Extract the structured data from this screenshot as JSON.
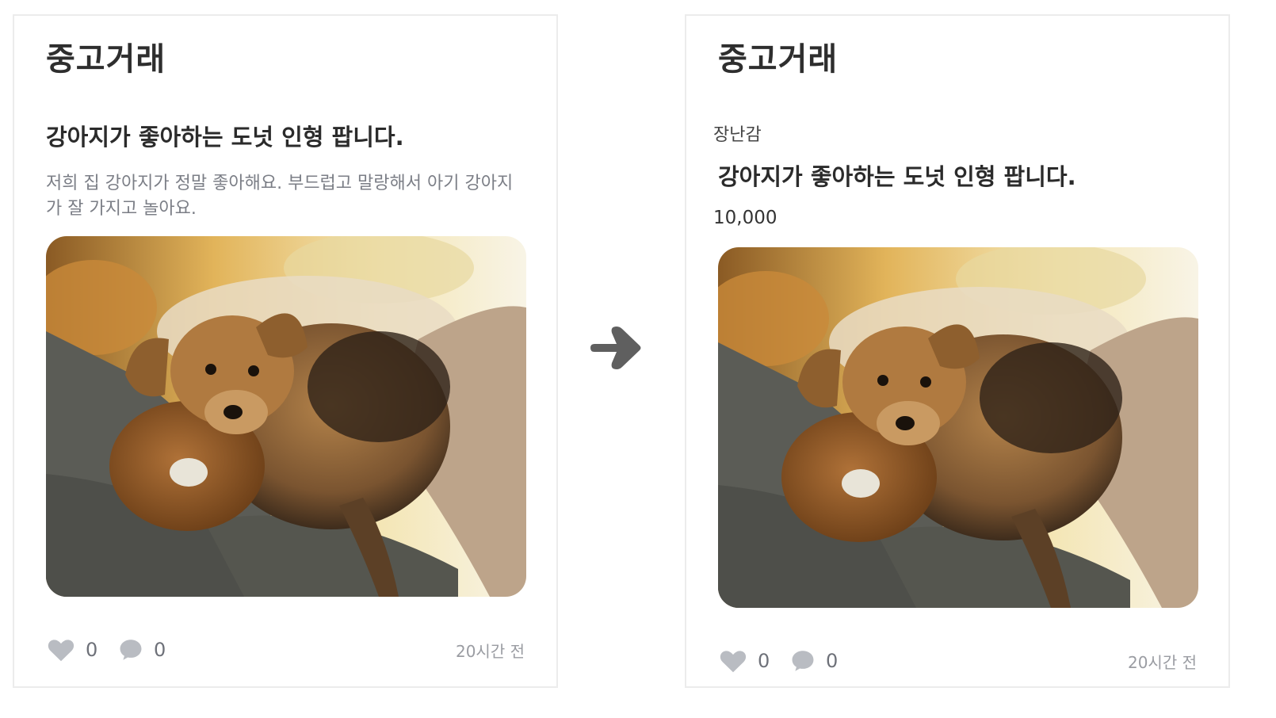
{
  "left_card": {
    "section_title": "중고거래",
    "post_title": "강아지가 좋아하는 도넛 인형 팝니다.",
    "description": "저희 집 강아지가 정말 좋아해요. 부드럽고 말랑해서 아기 강아지가 잘 가지고 놀아요.",
    "likes": "0",
    "comments": "0",
    "time": "20시간 전"
  },
  "right_card": {
    "section_title": "중고거래",
    "category": "장난감",
    "post_title": "강아지가 좋아하는 도넛 인형 팝니다.",
    "price": "10,000",
    "likes": "0",
    "comments": "0",
    "time": "20시간 전"
  },
  "icons": {
    "like": "heart-icon",
    "comment": "speech-bubble-icon",
    "transition": "arrow-right-icon"
  },
  "colors": {
    "icon_gray": "#b9bcc2",
    "text_muted": "#7b7e86",
    "arrow": "#5f5f5f"
  }
}
